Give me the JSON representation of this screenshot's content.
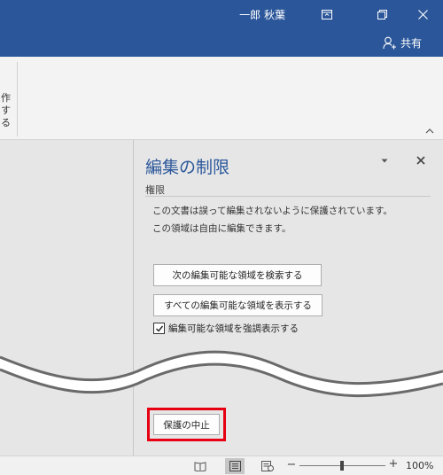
{
  "titlebar": {
    "user_name": "一郎 秋葉",
    "icons": {
      "ribbon_display": "ribbon-display-icon",
      "restore": "restore-icon",
      "close": "close-icon"
    }
  },
  "ribbon": {
    "share_label": "共有",
    "share_icon": "person-add-icon",
    "partial_label": "作する"
  },
  "pane": {
    "title": "編集の制限",
    "section_label": "権限",
    "info_line_1": "この文書は誤って編集されないように保護されています。",
    "info_line_2": "この領域は自由に編集できます。",
    "find_next_region": "次の編集可能な領域を検索する",
    "show_all_regions": "すべての編集可能な領域を表示する",
    "highlight_label": "編集可能な領域を強調表示する",
    "highlight_checked": true,
    "stop_protection": "保護の中止"
  },
  "statusbar": {
    "zoom_out": "−",
    "zoom_in": "+",
    "zoom_level": "100%",
    "zoom_value": 100
  },
  "colors": {
    "accent": "#2b579a",
    "highlight_box": "#e60012"
  }
}
